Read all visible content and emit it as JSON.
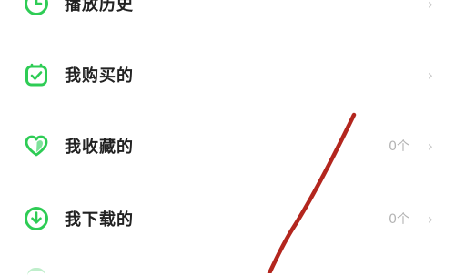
{
  "menu": {
    "items": [
      {
        "label": "播放历史",
        "count": "",
        "icon": "clock-icon"
      },
      {
        "label": "我购买的",
        "count": "",
        "icon": "purchase-bag-icon"
      },
      {
        "label": "我收藏的",
        "count": "0个",
        "icon": "heart-icon"
      },
      {
        "label": "我下载的",
        "count": "0个",
        "icon": "download-icon"
      }
    ]
  },
  "colors": {
    "accent": "#2ecc55",
    "annotation": "#b3261e"
  }
}
